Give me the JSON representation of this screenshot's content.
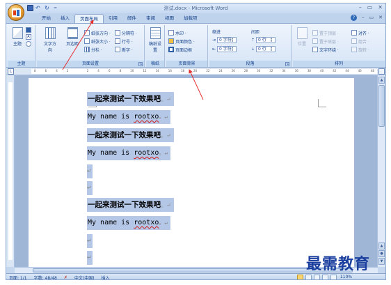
{
  "window": {
    "title": "测试.docx - Microsoft Word",
    "controls": [
      "–",
      "▭",
      "✕"
    ],
    "qat_more": "="
  },
  "tabs": [
    {
      "label": "开始"
    },
    {
      "label": "插入"
    },
    {
      "label": "页面布局",
      "active": true
    },
    {
      "label": "引用"
    },
    {
      "label": "邮件"
    },
    {
      "label": "审阅"
    },
    {
      "label": "视图"
    },
    {
      "label": "加载项"
    }
  ],
  "tab_right": {
    "help": "?",
    "minimize": "–",
    "restore": "▭",
    "close": "✕"
  },
  "ribbon": {
    "theme": {
      "label": "主题",
      "big": "主题",
      "group": "主题"
    },
    "page_setup": {
      "big1": "文字方向",
      "big2": "页边距",
      "rows": [
        "纸张方向 ·",
        "纸张大小 ·",
        "分栏 ·"
      ],
      "rows2": [
        "分隔符 ·",
        "行号 ·",
        "断字 ·"
      ],
      "group": "页面设置"
    },
    "draft": {
      "big": "稿纸设置",
      "group": "稿纸"
    },
    "page_background": {
      "rows": [
        "水印 ·",
        "页面颜色 ·",
        "页面边框"
      ],
      "group": "页面背景"
    },
    "paragraph": {
      "indent_label": "缩进",
      "spacing_label": "间距",
      "indent_left": "0 字符",
      "indent_right": "0 字符",
      "space_before": "0 行",
      "space_after": "0 行",
      "group": "段落"
    },
    "arrange": {
      "position": "位置",
      "rows": [
        "置于顶层 ·",
        "置于底层 ·",
        "文字环绕 ·"
      ],
      "rows2": [
        "对齐 ·",
        "组合 ·",
        "旋转 ·"
      ],
      "group": "排列"
    }
  },
  "ruler": {
    "box": "L",
    "ticks": [
      "8",
      "6",
      "4",
      "2",
      "",
      "2",
      "4",
      "6",
      "8",
      "10",
      "12",
      "14",
      "16",
      "18",
      "20",
      "22",
      "24",
      "26",
      "28",
      "30",
      "32",
      "34",
      "36",
      "38",
      "40",
      "42",
      "44",
      "46",
      "48"
    ]
  },
  "document": {
    "paragraphs": [
      {
        "type": "cn",
        "text": "一起来测试一下效果吧",
        "end": "。↵"
      },
      {
        "type": "en",
        "pre": "My name is ",
        "wavy": "rootxo",
        "end": "。↵"
      },
      {
        "type": "cn",
        "text": "一起来测试一下效果吧",
        "end": "。↵"
      },
      {
        "type": "en",
        "pre": "My name is ",
        "wavy": "rootxo",
        "end": "。↵"
      },
      {
        "type": "empty",
        "end": "↵"
      },
      {
        "type": "empty",
        "end": "↵"
      },
      {
        "type": "cn",
        "text": "一起来测试一下效果吧",
        "end": "。↵"
      },
      {
        "type": "en",
        "pre": "My name is ",
        "wavy": "rootxo",
        "end": "。↵"
      },
      {
        "type": "empty",
        "end": "↵"
      },
      {
        "type": "empty",
        "end": "↵"
      }
    ]
  },
  "statusbar": {
    "page": "页面: 1/1",
    "words": "字数: 48/48",
    "lang": "中文(中国)",
    "mode": "插入",
    "zoom": "110%"
  },
  "watermark": "最需教育",
  "colors": {
    "ribbon_blue": "#c4d7ef",
    "selection": "#b4c7e6",
    "annotation_red": "#e53030",
    "watermark_blue": "#1b3f9e"
  }
}
